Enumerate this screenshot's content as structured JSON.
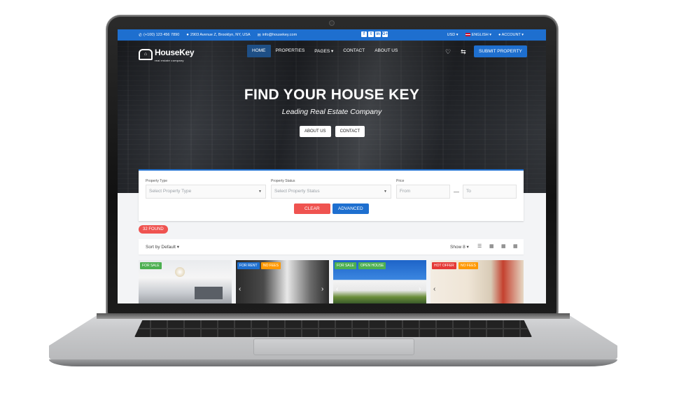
{
  "topbar": {
    "phone": "(+100) 123 456 7890",
    "address": "2903 Avenue Z, Brooklyn, NY, USA",
    "email": "info@housekey.com",
    "social": [
      "f",
      "t",
      "in",
      "G+"
    ],
    "currency": "USD",
    "language": "ENGLISH",
    "account": "ACCOUNT"
  },
  "brand": {
    "name": "HouseKey",
    "tagline": "real estate company"
  },
  "nav": {
    "items": [
      "HOME",
      "PROPERTIES",
      "PAGES",
      "CONTACT",
      "ABOUT US"
    ],
    "submit_label": "SUBMIT PROPERTY"
  },
  "hero": {
    "title": "FIND YOUR HOUSE KEY",
    "subtitle": "Leading Real Estate Company",
    "btn_about": "ABOUT US",
    "btn_contact": "CONTACT"
  },
  "search": {
    "type_label": "Property Type",
    "type_placeholder": "Select Property Type",
    "status_label": "Property Status",
    "status_placeholder": "Select Property Status",
    "price_label": "Price",
    "price_from": "From",
    "price_to": "To",
    "clear_label": "CLEAR",
    "advanced_label": "ADVANCED"
  },
  "results": {
    "found": "32 FOUND",
    "sort_label": "Sort by Default",
    "show_label": "Show 8"
  },
  "listings": [
    {
      "badges": [
        "FOR SALE"
      ]
    },
    {
      "badges": [
        "FOR RENT",
        "NO FEES"
      ]
    },
    {
      "badges": [
        "FOR SALE",
        "OPEN HOUSE"
      ]
    },
    {
      "badges": [
        "HOT OFFER",
        "NO FEES"
      ]
    }
  ],
  "colors": {
    "primary": "#1e6fcf",
    "accent": "#ef5350",
    "success": "#4caf50",
    "warning": "#ff9800"
  }
}
